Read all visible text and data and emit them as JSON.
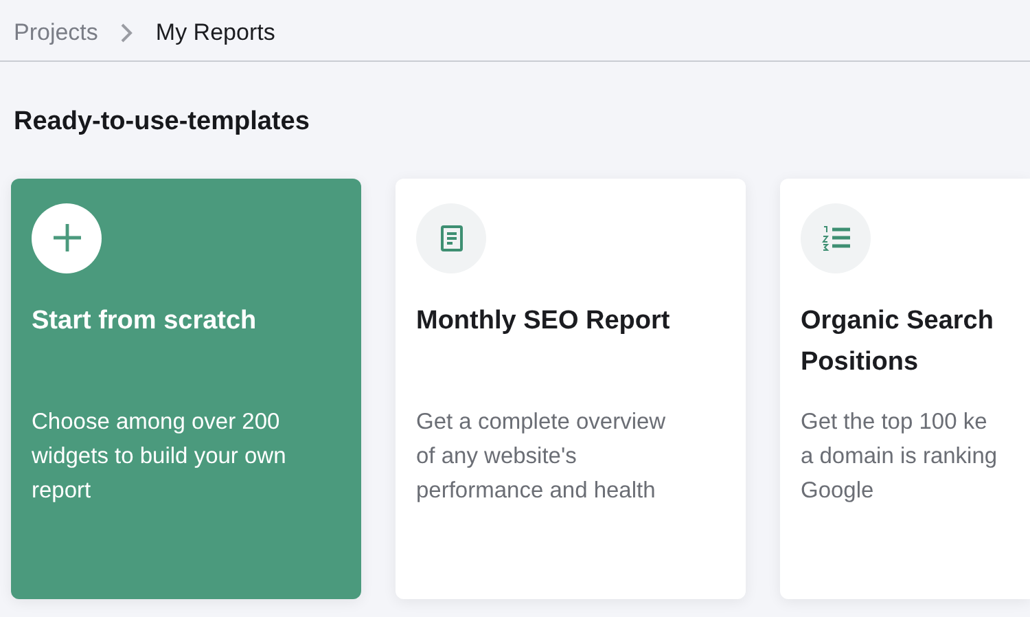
{
  "breadcrumb": [
    {
      "label": "Projects",
      "current": false
    },
    {
      "label": "My Reports",
      "current": true
    }
  ],
  "heading": "Ready-to-use-templates",
  "templates": [
    {
      "kind": "scratch",
      "title_lines": [
        "Start from scratch"
      ],
      "description_lines": [
        "Choose among over 200",
        "widgets to build your own",
        "report"
      ]
    },
    {
      "kind": "document",
      "title_lines": [
        "Monthly SEO Report"
      ],
      "description_lines": [
        "Get a complete overview",
        "of any website's",
        "performance and health"
      ]
    },
    {
      "kind": "numbered-list",
      "title_lines": [
        "Organic Search",
        "Positions"
      ],
      "description_lines": [
        "Get the top 100 ke",
        "a domain is ranking",
        "Google"
      ]
    }
  ]
}
